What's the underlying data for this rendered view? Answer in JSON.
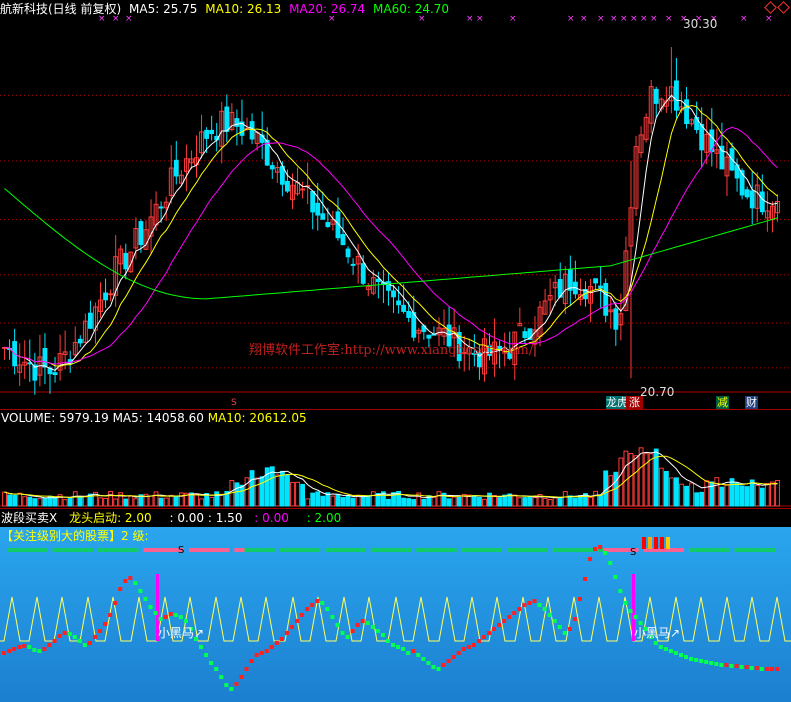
{
  "header": {
    "title": "航新科技(日线 前复权)",
    "ma5": "MA5: 25.75",
    "ma10": "MA10: 26.13",
    "ma20": "MA20: 26.74",
    "ma60": "MA60: 24.70"
  },
  "price_panel": {
    "high_label": "30.30",
    "low_label": "20.70",
    "watermark": "翔博软件工作室:http://www.xiangbosoft.com/",
    "tags": [
      "龙虎榜",
      "涨",
      "减",
      "财"
    ]
  },
  "volume_panel": {
    "volume": "VOLUME: 5979.19",
    "ma5": "MA5: 14058.60",
    "ma10": "MA10: 20612.05"
  },
  "indicator_panel": {
    "name": "波段买卖X",
    "dragon_label": "龙头启动: 2.00",
    "val1": ": 0.00",
    "val2": ": 1.50",
    "val3": ": 0.00",
    "val4": ": 2.00",
    "banner": "【关注级别大的股票】2 级:",
    "horse1": "小黑马↗",
    "horse2": "小黑马↗"
  },
  "colors": {
    "up": "#ff3c3c",
    "down": "#00e5ff",
    "ma5": "#ffffff",
    "ma10": "#ffff00",
    "ma20": "#ff00ff",
    "ma60": "#00ff00",
    "indicator_bg": "#2a9fe8"
  },
  "chart_data": [
    {
      "type": "candlestick",
      "title": "航新科技(日线 前复权)",
      "series": [
        {
          "name": "MA5",
          "last": 25.75
        },
        {
          "name": "MA10",
          "last": 26.13
        },
        {
          "name": "MA20",
          "last": 26.74
        },
        {
          "name": "MA60",
          "last": 24.7
        }
      ],
      "annotations": [
        {
          "label": "30.30",
          "kind": "high"
        },
        {
          "label": "20.70",
          "kind": "low"
        }
      ],
      "close_path": [
        21.6,
        21.3,
        21.0,
        20.9,
        21.4,
        22.1,
        22.9,
        23.8,
        24.4,
        25.1,
        25.9,
        26.7,
        27.3,
        27.9,
        28.1,
        28.0,
        27.6,
        27.0,
        26.5,
        26.0,
        25.4,
        24.9,
        24.3,
        23.6,
        23.0,
        22.6,
        22.3,
        22.1,
        21.9,
        21.6,
        21.4,
        21.4,
        21.6,
        22.1,
        22.6,
        23.2,
        23.6,
        23.4,
        22.9,
        22.4,
        27.5,
        28.9,
        29.2,
        28.6,
        27.9,
        27.2,
        26.6,
        26.1,
        25.9,
        26.0
      ]
    },
    {
      "type": "bar",
      "title": "VOLUME",
      "series": [
        {
          "name": "VOLUME",
          "last": 5979.19
        },
        {
          "name": "MA5",
          "last": 14058.6
        },
        {
          "name": "MA10",
          "last": 20612.05
        }
      ]
    },
    {
      "type": "line",
      "title": "波段买卖X",
      "values": {
        "龙头启动": 2.0
      }
    }
  ]
}
